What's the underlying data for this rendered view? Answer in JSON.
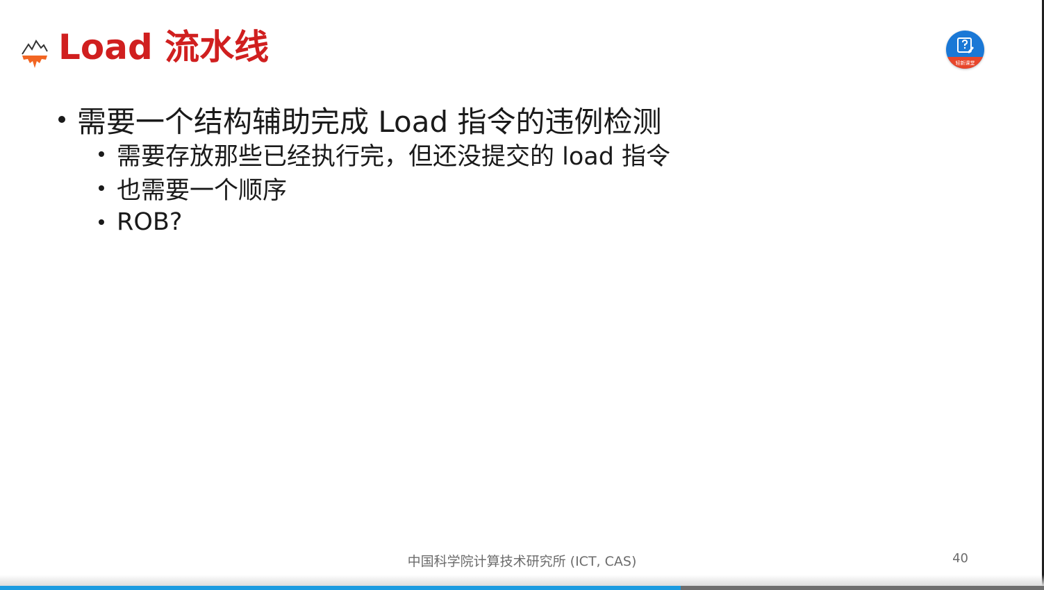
{
  "slide": {
    "title": "Load 流水线",
    "bullets": [
      {
        "text": "需要一个结构辅助完成 Load 指令的违例检测",
        "sub": [
          "需要存放那些已经执行完，但还没提交的 load 指令",
          "也需要一个顺序",
          "ROB?"
        ]
      }
    ],
    "footer": "中国科学院计算技术研究所 (ICT, CAS)",
    "page_number": "40"
  },
  "badge": {
    "label": "轻新课堂",
    "icon": "question-edit-icon"
  },
  "logo": {
    "icon": "mountain-logo-icon"
  },
  "player": {
    "progress_fraction": 0.652
  },
  "colors": {
    "title": "#d01f1f",
    "body_text": "#1a1a1a",
    "footer_text": "#6b6b6b",
    "badge_blue": "#1a78d6",
    "badge_band": "#e8462a",
    "progress": "#1b9be0",
    "logo_orange": "#f26522"
  }
}
